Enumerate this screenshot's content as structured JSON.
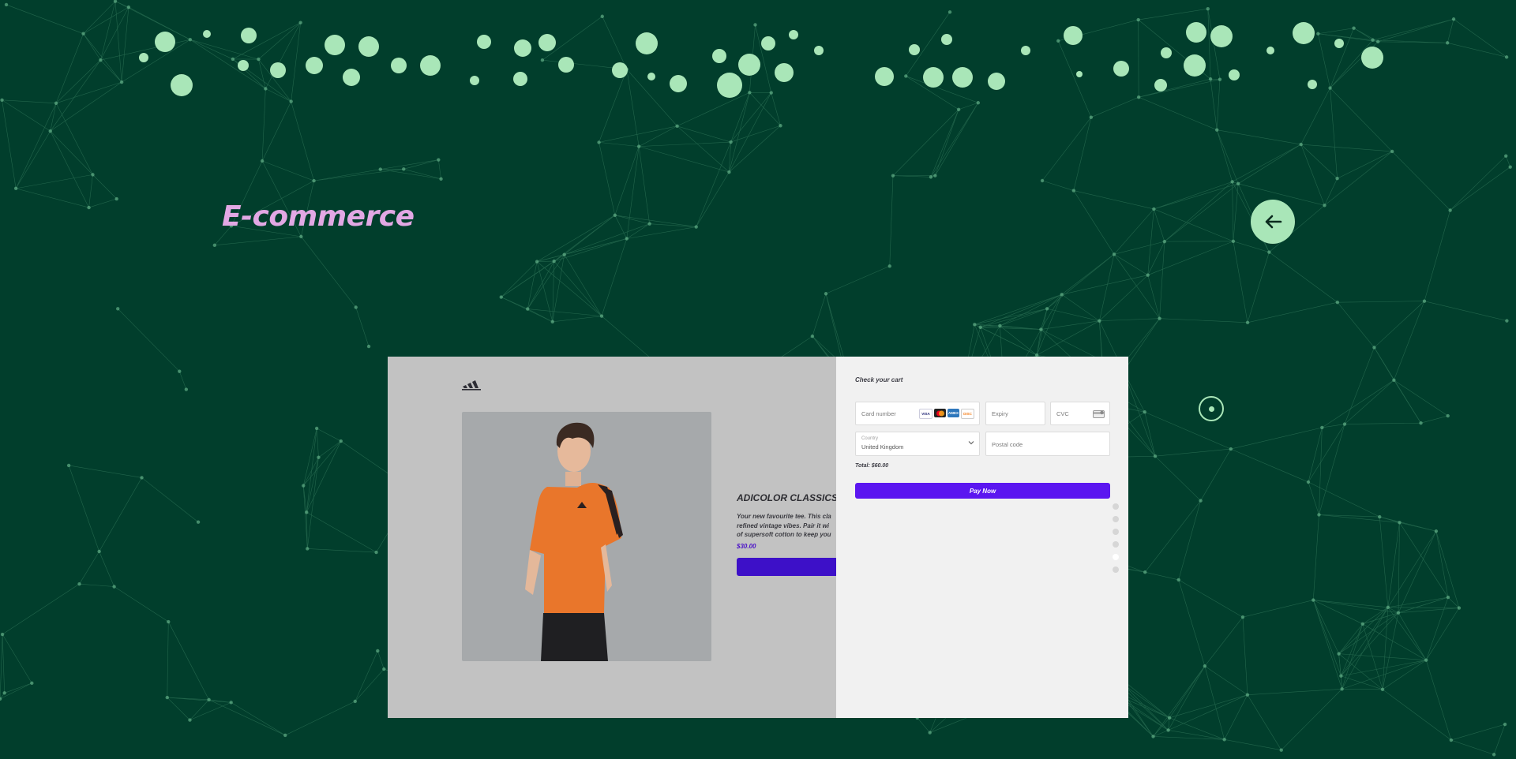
{
  "page": {
    "title": "E-commerce"
  },
  "colors": {
    "background": "#013e2c",
    "accent_green": "#a9e6b8",
    "title_pink": "#e2a8e4",
    "pay_button": "#5b16f0"
  },
  "icons": {
    "back": "arrow-left-icon",
    "cursor": "target-icon",
    "logo": "adidas-logo"
  },
  "product": {
    "name": "ADICOLOR CLASSICS",
    "description_lines": [
      "Your new favourite tee. This cla",
      "refined vintage vibes. Pair it wi",
      "of supersoft cotton to keep you"
    ],
    "price": "$30.00"
  },
  "checkout": {
    "heading": "Check your cart",
    "card_number_placeholder": "Card number",
    "card_brands": [
      "VISA",
      "MC",
      "AMEX",
      "DISC"
    ],
    "expiry_placeholder": "Expiry",
    "cvc_placeholder": "CVC",
    "country_label": "Country",
    "country_value": "United Kingdom",
    "postal_placeholder": "Postal code",
    "total": "Total: $60.00",
    "pay_label": "Pay Now"
  },
  "carousel": {
    "count": 6,
    "active_index": 4
  }
}
